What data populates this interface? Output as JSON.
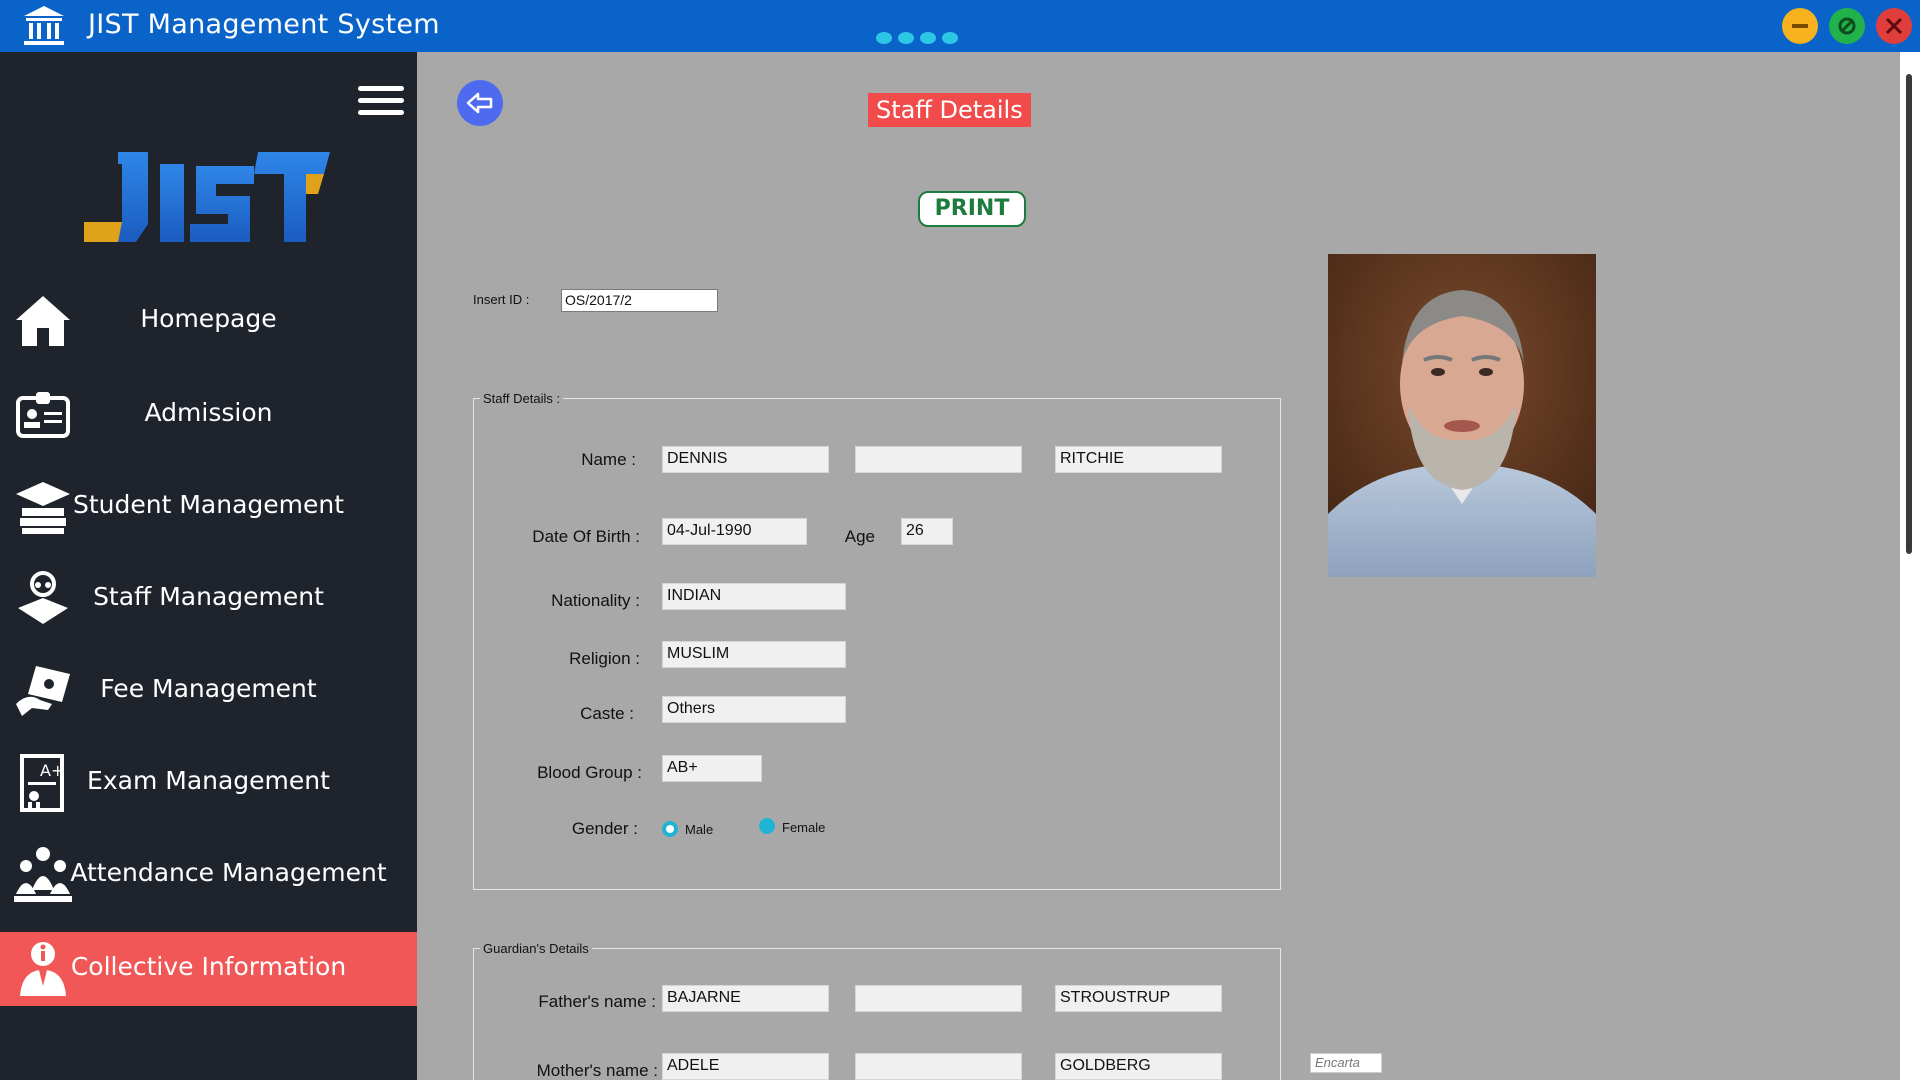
{
  "window": {
    "title": "JIST Management System"
  },
  "sidebar": {
    "items": [
      {
        "label": "Homepage",
        "icon": "home-icon"
      },
      {
        "label": "Admission",
        "icon": "id-card-icon"
      },
      {
        "label": "Student Management",
        "icon": "graduation-cap-icon"
      },
      {
        "label": "Staff Management",
        "icon": "teacher-icon"
      },
      {
        "label": "Fee Management",
        "icon": "money-hand-icon"
      },
      {
        "label": "Exam Management",
        "icon": "certificate-icon"
      },
      {
        "label": "Attendance Management",
        "icon": "group-icon"
      },
      {
        "label": "Collective Information",
        "icon": "info-person-icon",
        "active": true
      }
    ]
  },
  "header": {
    "page_title": "Staff Details",
    "print_label": "PRINT"
  },
  "insert": {
    "label": "Insert ID :",
    "value": "OS/2017/2"
  },
  "staff": {
    "group_title": "Staff Details :",
    "name_label": "Name :",
    "first_name": "DENNIS",
    "middle_name": "",
    "last_name": "RITCHIE",
    "dob_label": "Date Of Birth :",
    "dob": "04-Jul-1990",
    "age_label": "Age",
    "age": "26",
    "nationality_label": "Nationality :",
    "nationality": "INDIAN",
    "religion_label": "Religion :",
    "religion": "MUSLIM",
    "caste_label": "Caste :",
    "caste": "Others",
    "blood_group_label": "Blood Group :",
    "blood_group": "AB+",
    "gender_label": "Gender :",
    "gender_options": [
      "Male",
      "Female"
    ],
    "gender_selected": "Male"
  },
  "guardian": {
    "group_title": "Guardian's Details",
    "father_label": "Father's name :",
    "father_first": "BAJARNE",
    "father_middle": "",
    "father_last": "STROUSTRUP",
    "mother_label": "Mother's name :",
    "mother_first": "ADELE",
    "mother_middle": "",
    "mother_last": "GOLDBERG"
  },
  "watermark": "Encarta",
  "colors": {
    "titlebar": "#0a63c9",
    "sidebar": "#1f232b",
    "active_item": "#f25757",
    "content_bg": "#a8a8a8",
    "title_badge": "#f24b4b",
    "print_green": "#1c7b3d",
    "radio_accent": "#1fb4d4"
  }
}
